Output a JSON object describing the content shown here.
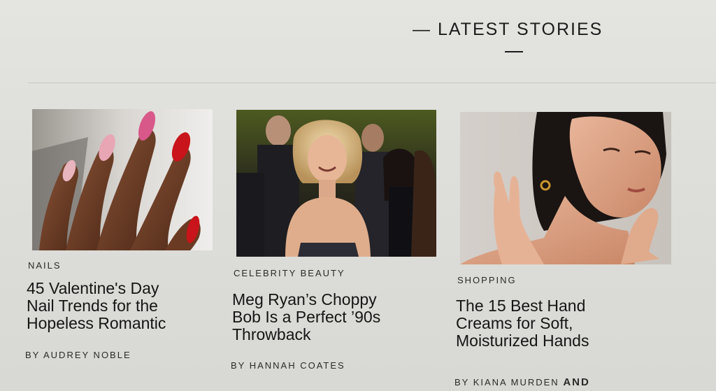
{
  "section": {
    "title": "— LATEST STORIES"
  },
  "stories": [
    {
      "image_alt": "Hand with pink, nude and red manicured nails",
      "category": "NAILS",
      "headline_lines": [
        "45 Valentine's Day",
        "Nail Trends for the",
        "Hopeless Romantic"
      ],
      "byline": "BY AUDREY NOBLE"
    },
    {
      "image_alt": "Meg Ryan with a blonde choppy bob at an event",
      "category": "CELEBRITY BEAUTY",
      "headline_lines": [
        "Meg Ryan’s Choppy",
        "Bob Is a Perfect ’90s",
        "Throwback"
      ],
      "byline": "BY HANNAH COATES"
    },
    {
      "image_alt": "Woman with hands raised to her face and neck",
      "category": "SHOPPING",
      "headline_lines": [
        "The 15 Best Hand",
        "Creams for Soft,",
        "Moisturized Hands"
      ],
      "byline": "BY KIANA MURDEN",
      "byline_suffix": "AND"
    }
  ]
}
